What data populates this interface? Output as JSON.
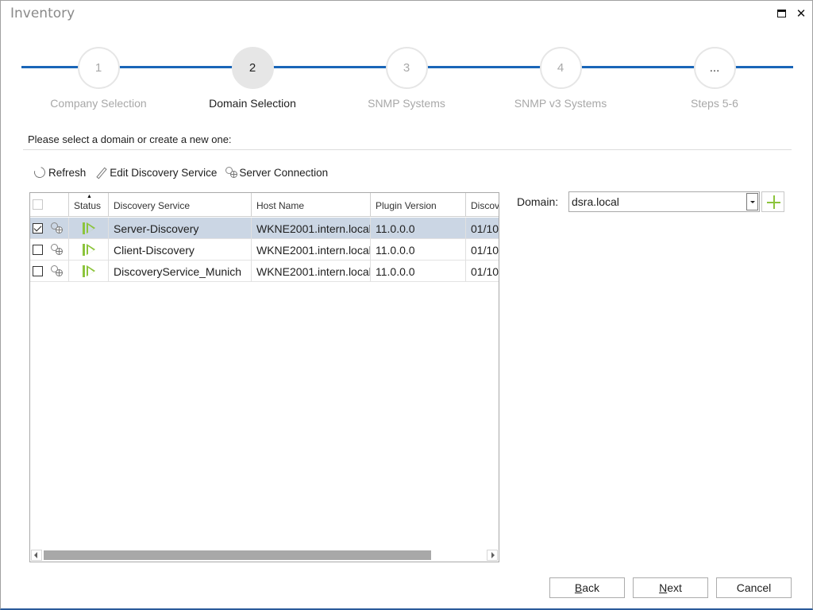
{
  "window": {
    "title": "Inventory",
    "maximize_icon": "maximize-icon",
    "close_icon": "close-icon"
  },
  "stepper": {
    "steps": [
      {
        "number": "1",
        "label": "Company Selection",
        "state": "done"
      },
      {
        "number": "2",
        "label": "Domain Selection",
        "state": "active"
      },
      {
        "number": "3",
        "label": "SNMP Systems",
        "state": "pending"
      },
      {
        "number": "4",
        "label": "SNMP v3 Systems",
        "state": "pending"
      },
      {
        "number": "...",
        "label": "Steps 5-6",
        "state": "pending"
      }
    ],
    "line_color": "#1a66b8"
  },
  "prompt": "Please select a domain or create a new one:",
  "toolbar": {
    "refresh": {
      "label": "Refresh",
      "icon": "refresh-icon"
    },
    "edit": {
      "label": "Edit Discovery Service",
      "icon": "pencil-icon"
    },
    "connection": {
      "label": "Server Connection",
      "icon": "server-connection-icon"
    }
  },
  "grid": {
    "columns": [
      "",
      "Status",
      "Discovery Service",
      "Host Name",
      "Plugin Version",
      "Discov"
    ],
    "sorted_column": "Status",
    "rows": [
      {
        "checked": true,
        "selected": true,
        "status": "running",
        "service": "Server-Discovery",
        "host": "WKNE2001.intern.local",
        "version": "11.0.0.0",
        "discovery": "01/10"
      },
      {
        "checked": false,
        "selected": false,
        "status": "running",
        "service": "Client-Discovery",
        "host": "WKNE2001.intern.local",
        "version": "11.0.0.0",
        "discovery": "01/10"
      },
      {
        "checked": false,
        "selected": false,
        "status": "running",
        "service": "DiscoveryService_Munich",
        "host": "WKNE2001.intern.local",
        "version": "11.0.0.0",
        "discovery": "01/10"
      }
    ],
    "status_color": "#8cc43c",
    "selected_row_color": "#cbd6e4"
  },
  "domain": {
    "label": "Domain:",
    "value": "dsra.local",
    "add_icon": "plus-icon",
    "add_color": "#8cc43c"
  },
  "footer": {
    "back": {
      "label": "Back",
      "mnemonic": "B",
      "rest": "ack"
    },
    "next": {
      "label": "Next",
      "mnemonic": "N",
      "rest": "ext"
    },
    "cancel": {
      "label": "Cancel"
    }
  }
}
